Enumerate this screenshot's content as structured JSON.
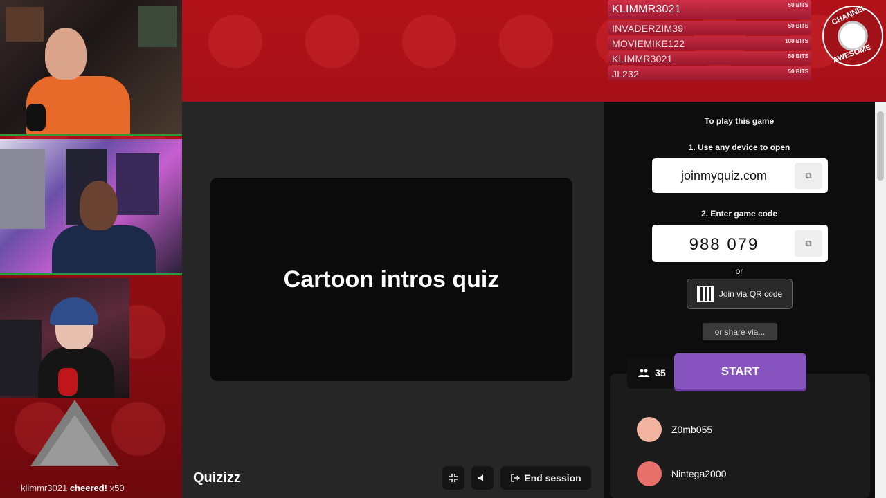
{
  "stream": {
    "cheer_user": "klimmr3021",
    "cheer_text": "cheered!",
    "cheer_amount": "x50"
  },
  "bits_leaderboard": [
    {
      "name": "KLIMMR3021",
      "amount": "50 BITS"
    },
    {
      "name": "INVADERZIM39",
      "amount": "50 BITS"
    },
    {
      "name": "MOVIEMIKE122",
      "amount": "100 BITS"
    },
    {
      "name": "KLIMMR3021",
      "amount": "50 BITS"
    },
    {
      "name": "JL232",
      "amount": "50 BITS"
    }
  ],
  "channel_logo": {
    "top_text": "CHANNEL",
    "bottom_text": "AWESOME"
  },
  "quiz": {
    "title": "Cartoon intros quiz",
    "brand": "Quizizz",
    "end_session_label": "End session",
    "fullscreen_icon": "compress-icon",
    "volume_icon": "volume-icon"
  },
  "join_panel": {
    "heading": "To play this game",
    "step1": "1. Use any device to open",
    "url": "joinmyquiz.com",
    "step2": "2. Enter game code",
    "code": "988 079",
    "or_text": "or",
    "qr_label": "Join via QR code",
    "share_label": "or share via...",
    "player_count": "35",
    "start_label": "START"
  },
  "players": [
    {
      "name": "Z0mb055",
      "avatar_color": "#f2b3a0"
    },
    {
      "name": "Nintega2000",
      "avatar_color": "#e8706a"
    }
  ],
  "colors": {
    "accent_purple": "#8854c0",
    "stream_red": "#b3121a"
  }
}
